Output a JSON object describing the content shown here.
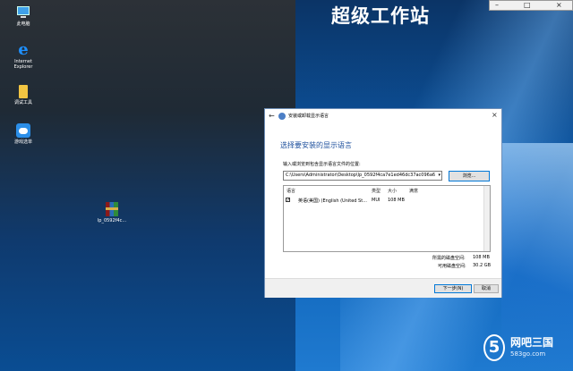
{
  "watermark_top": "超级工作站",
  "desktop_icons": [
    {
      "label": "此电脑",
      "icon": "computer-icon"
    },
    {
      "label": "Internet Explorer",
      "icon": "internet-explorer-icon"
    },
    {
      "label": "调试工具",
      "icon": "folder-icon"
    },
    {
      "label": "游戏选单",
      "icon": "game-controller-icon"
    },
    {
      "label": "lp_0592f4c...",
      "icon": "archive-icon"
    }
  ],
  "dialog": {
    "title": "安装或卸载显示语言",
    "heading": "选择要安装的显示语言",
    "path_label": "输入或浏览到包含显示语言文件的位置:",
    "path_value": "C:\\Users\\Administrator\\Desktop\\lp_0592f4ca7e1ed46dc37ac096a6",
    "browse_label": "浏览...",
    "columns": [
      "语言",
      "类型",
      "大小",
      "满意"
    ],
    "rows": [
      {
        "checked": true,
        "language": "英语(美国) (English (United St...",
        "type": "MUI",
        "size": "108 MB",
        "status": ""
      }
    ],
    "required_label": "所需的磁盘空间:",
    "required_value": "108 MB",
    "available_label": "可用磁盘空间:",
    "available_value": "30.2 GB",
    "next_label": "下一步(N)",
    "cancel_label": "取消"
  },
  "logo": {
    "digit": "5",
    "name": "网吧三国",
    "site": "583go.com"
  },
  "colors": {
    "accent": "#0078d7",
    "heading": "#1d4f9c"
  }
}
